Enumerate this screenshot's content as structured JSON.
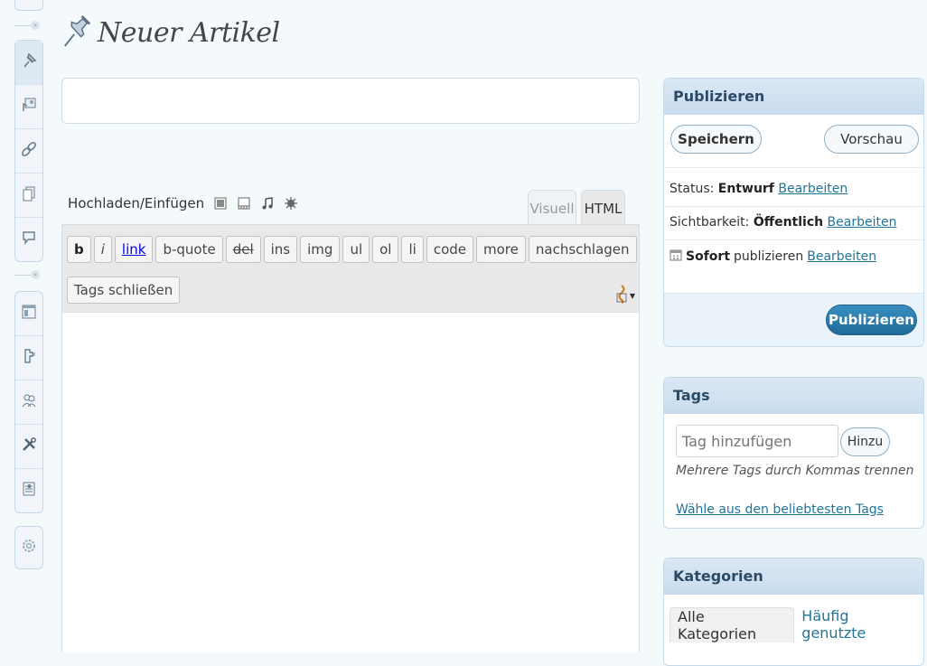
{
  "page": {
    "title": "Neuer Artikel"
  },
  "menu": {
    "group1": [
      "posts-icon",
      "media-icon",
      "links-icon",
      "pages-icon",
      "comments-icon"
    ],
    "group2": [
      "appearance-icon",
      "plugins-icon",
      "users-icon",
      "tools-icon",
      "settings-icon"
    ]
  },
  "editor": {
    "media_label": "Hochladen/Einfügen",
    "tab_visual": "Visuell",
    "tab_html": "HTML",
    "buttons_row1": [
      "b",
      "i",
      "link",
      "b-quote",
      "del",
      "ins",
      "img",
      "ul",
      "ol",
      "li",
      "code",
      "more",
      "nachschlagen"
    ],
    "button_close_tags": "Tags schließen"
  },
  "publish": {
    "title": "Publizieren",
    "save_label": "Speichern",
    "preview_label": "Vorschau",
    "status_label": "Status:",
    "status_value": "Entwurf",
    "visibility_label": "Sichtbarkeit:",
    "visibility_value": "Öffentlich",
    "schedule_value": "Sofort",
    "schedule_label": "publizieren",
    "edit_link": "Bearbeiten",
    "publish_button": "Publizieren"
  },
  "tags": {
    "title": "Tags",
    "input_placeholder": "Tag hinzufügen",
    "add_button": "Hinzu",
    "hint": "Mehrere Tags durch Kommas trennen",
    "popular_link": "Wähle aus den beliebtesten Tags"
  },
  "categories": {
    "title": "Kategorien",
    "tab_all": "Alle Kategorien",
    "tab_popular": "Häufig genutzte"
  }
}
